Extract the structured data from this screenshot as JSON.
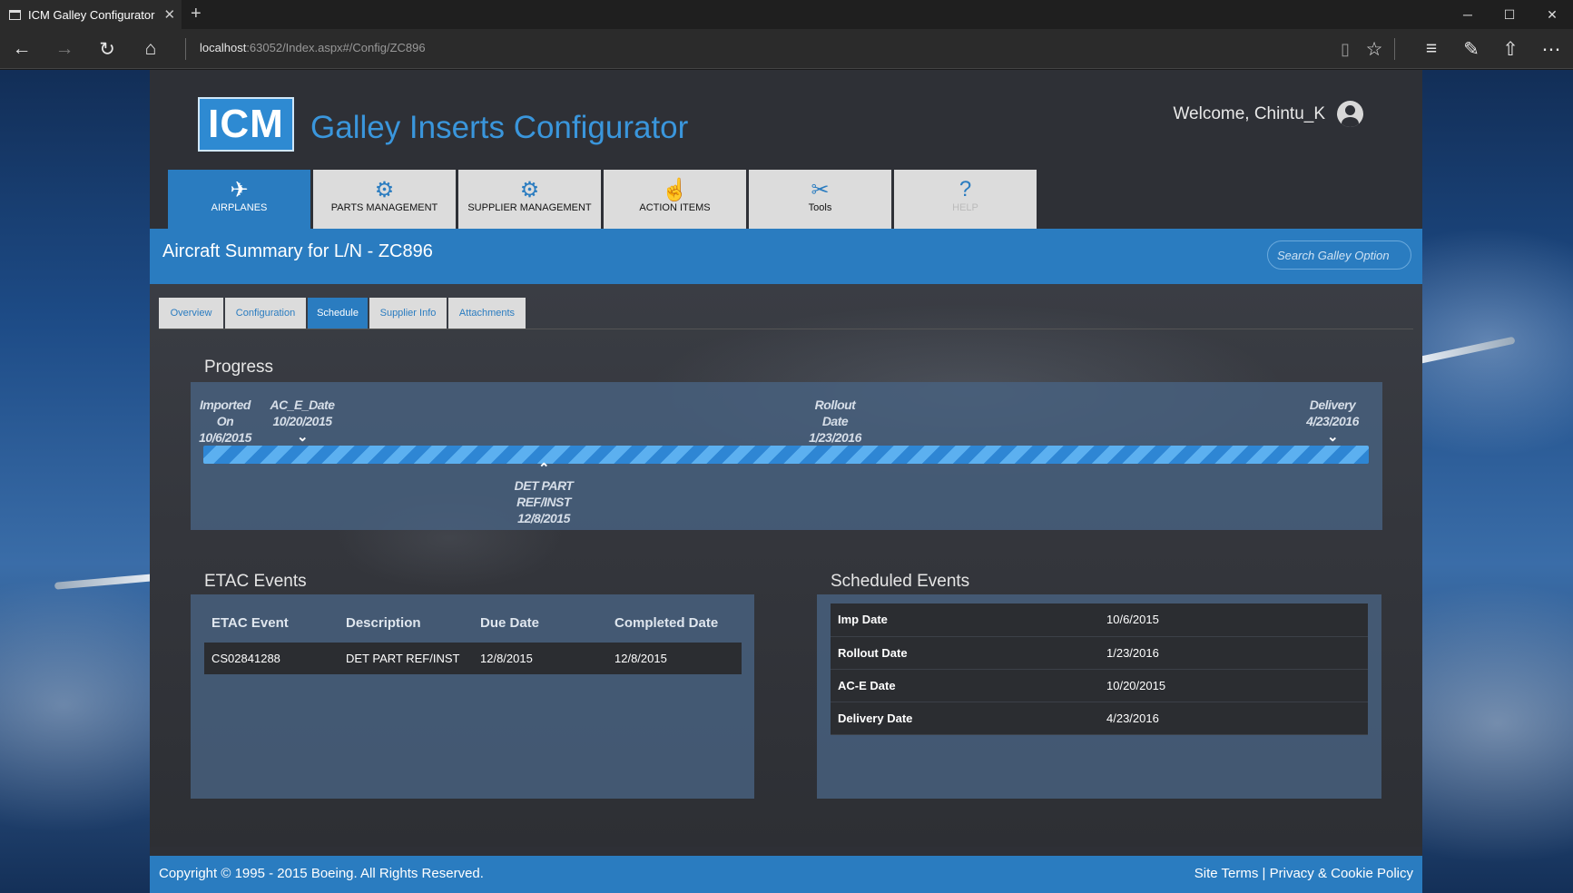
{
  "browser": {
    "tab_title": "ICM Galley Configurator",
    "address_host": "localhost",
    "address_path": ":63052/Index.aspx#/Config/ZC896"
  },
  "header": {
    "logo_text": "ICM",
    "app_title": "Galley Inserts Configurator",
    "welcome": "Welcome, Chintu_K"
  },
  "menu": [
    {
      "label": "AIRPLANES",
      "icon": "airplane-icon",
      "glyph": "✈",
      "active": true
    },
    {
      "label": "PARTS MANAGEMENT",
      "icon": "gear-icon",
      "glyph": "⚙"
    },
    {
      "label": "SUPPLIER MANAGEMENT",
      "icon": "supplier-icon",
      "glyph": "⚙"
    },
    {
      "label": "ACTION ITEMS",
      "icon": "hand-icon",
      "glyph": "☝"
    },
    {
      "label": "Tools",
      "icon": "tools-icon",
      "glyph": "✂"
    },
    {
      "label": "HELP",
      "icon": "help-icon",
      "glyph": "?",
      "disabled": true
    }
  ],
  "summary": {
    "title": "Aircraft Summary for L/N - ZC896",
    "search_placeholder": "Search Galley Option"
  },
  "subtabs": [
    "Overview",
    "Configuration",
    "Schedule",
    "Supplier Info",
    "Attachments"
  ],
  "active_subtab": "Schedule",
  "progress": {
    "title": "Progress",
    "milestones_above": [
      {
        "label": "Imported On",
        "date": "10/6/2015"
      },
      {
        "label": "AC_E_Date",
        "date": "10/20/2015"
      },
      {
        "label": "Rollout Date",
        "date": "1/23/2016"
      },
      {
        "label": "Delivery",
        "date": "4/23/2016"
      }
    ],
    "milestone_below": {
      "line1": "DET PART",
      "line2": "REF/INST",
      "date": "12/8/2015"
    }
  },
  "etac": {
    "title": "ETAC Events",
    "columns": [
      "ETAC Event",
      "Description",
      "Due Date",
      "Completed Date"
    ],
    "rows": [
      [
        "CS02841288",
        "DET PART REF/INST",
        "12/8/2015",
        "12/8/2015"
      ]
    ]
  },
  "scheduled": {
    "title": "Scheduled Events",
    "rows": [
      [
        "Imp Date",
        "10/6/2015"
      ],
      [
        "Rollout Date",
        "1/23/2016"
      ],
      [
        "AC-E Date",
        "10/20/2015"
      ],
      [
        "Delivery Date",
        "4/23/2016"
      ]
    ]
  },
  "footer": {
    "copyright": "Copyright © 1995 - 2015 Boeing. All Rights Reserved.",
    "site_terms": "Site Terms",
    "separator": " | ",
    "privacy": "Privacy & Cookie Policy"
  },
  "colors": {
    "accent": "#2a7cc0",
    "panel": "#486280",
    "app_bg": "#2e3036"
  }
}
